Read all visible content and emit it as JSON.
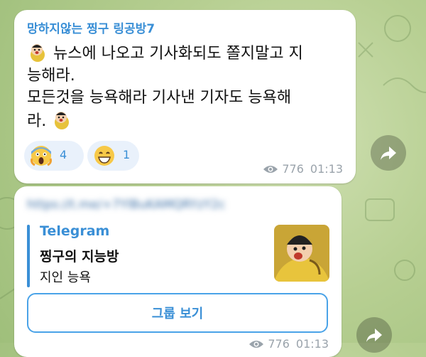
{
  "message1": {
    "sender": "망하지않는 찡구 링공방7",
    "line1": "뉴스에 나오고 기사화되도 쫄지말고 지",
    "line2": "능해라.",
    "line3": "모든것을 능욕해라 기사낸 기자도 능욕해",
    "line4": "라.",
    "reactions": [
      {
        "emoji": "screaming-face",
        "count": "4"
      },
      {
        "emoji": "grinning-face",
        "count": "1"
      }
    ],
    "views": "776",
    "time": "01:13"
  },
  "message2": {
    "link_url": "https://t.me/+7YlBuKAMQRYzY2c",
    "preview": {
      "site": "Telegram",
      "title": "찡구의 지능방",
      "description": "지인 능욕"
    },
    "button_label": "그룹 보기",
    "views": "776",
    "time": "01:13"
  },
  "colors": {
    "accent": "#3a8fd6",
    "bubble": "#ffffff",
    "meta": "#9aa3ab"
  },
  "icons": [
    "sticker-icon",
    "eye-icon",
    "share-icon",
    "thumbnail-image"
  ]
}
